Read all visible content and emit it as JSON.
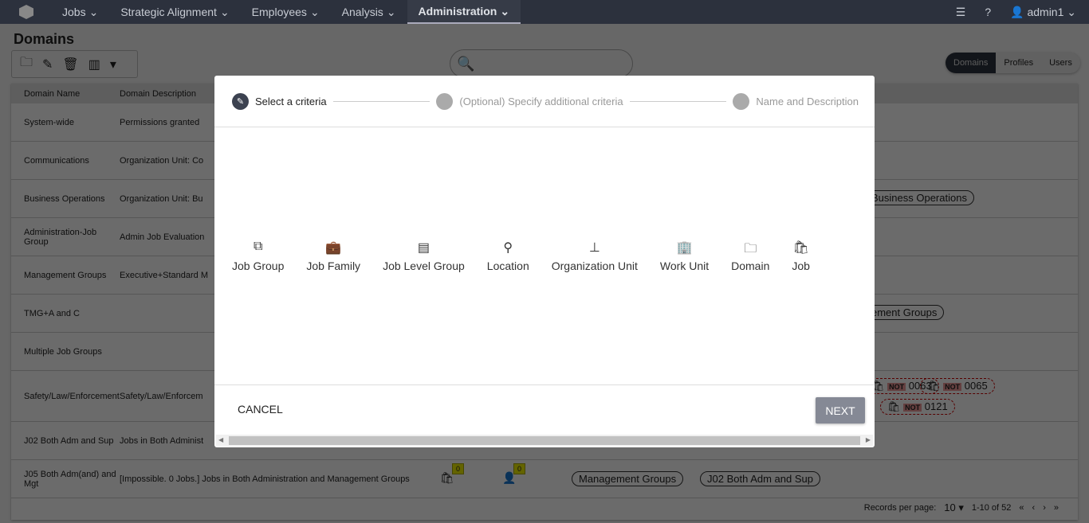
{
  "nav": {
    "items": [
      "Jobs",
      "Strategic Alignment",
      "Employees",
      "Analysis",
      "Administration"
    ],
    "active": "Administration",
    "user": "admin1"
  },
  "page": {
    "title": "Domains",
    "view_tabs": [
      "Domains",
      "Profiles",
      "Users"
    ],
    "active_tab": "Domains"
  },
  "table": {
    "headers": [
      "Domain Name",
      "Domain Description"
    ],
    "rows": [
      {
        "name": "System-wide",
        "desc": "Permissions granted"
      },
      {
        "name": "Communications",
        "desc": "Organization Unit: Co"
      },
      {
        "name": "Business Operations",
        "desc": "Organization Unit: Bu",
        "chips": [
          "Business Operations"
        ]
      },
      {
        "name": "Administration-Job Group",
        "desc": "Admin Job Evaluation"
      },
      {
        "name": "Management Groups",
        "desc": "Executive+Standard M"
      },
      {
        "name": "TMG+A and C",
        "desc": "",
        "chips": [
          "ement Groups"
        ]
      },
      {
        "name": "Multiple Job Groups",
        "desc": ""
      },
      {
        "name": "Safety/Law/Enforcement",
        "desc": "Safety/Law/Enforcem",
        "not_chips": [
          "0063",
          "0065",
          "0121"
        ],
        "not_label": "NOT"
      },
      {
        "name": "J02 Both Adm and Sup",
        "desc": "Jobs in Both Administ"
      },
      {
        "name": "J05 Both Adm(and) and Mgt",
        "desc": "[Impossible. 0 Jobs.] Jobs in Both Administration and Management Groups",
        "job_count": "0",
        "employee_count": "0",
        "chips": [
          "Management Groups",
          "J02 Both Adm and Sup"
        ]
      }
    ]
  },
  "pagination": {
    "label": "Records per page:",
    "per_page": "10",
    "range": "1-10 of 52"
  },
  "modal": {
    "steps": [
      "Select a criteria",
      "(Optional) Specify additional criteria",
      "Name and Description"
    ],
    "criteria": [
      {
        "label": "Job Group",
        "icon": "job-group-icon"
      },
      {
        "label": "Job Family",
        "icon": "briefcase-filled-icon"
      },
      {
        "label": "Job Level Group",
        "icon": "levels-icon"
      },
      {
        "label": "Location",
        "icon": "map-pin-icon"
      },
      {
        "label": "Organization Unit",
        "icon": "org-chart-icon"
      },
      {
        "label": "Work Unit",
        "icon": "building-icon"
      },
      {
        "label": "Domain",
        "icon": "folder-key-icon"
      },
      {
        "label": "Job",
        "icon": "briefcase-outline-icon"
      }
    ],
    "cancel": "CANCEL",
    "next": "NEXT"
  }
}
